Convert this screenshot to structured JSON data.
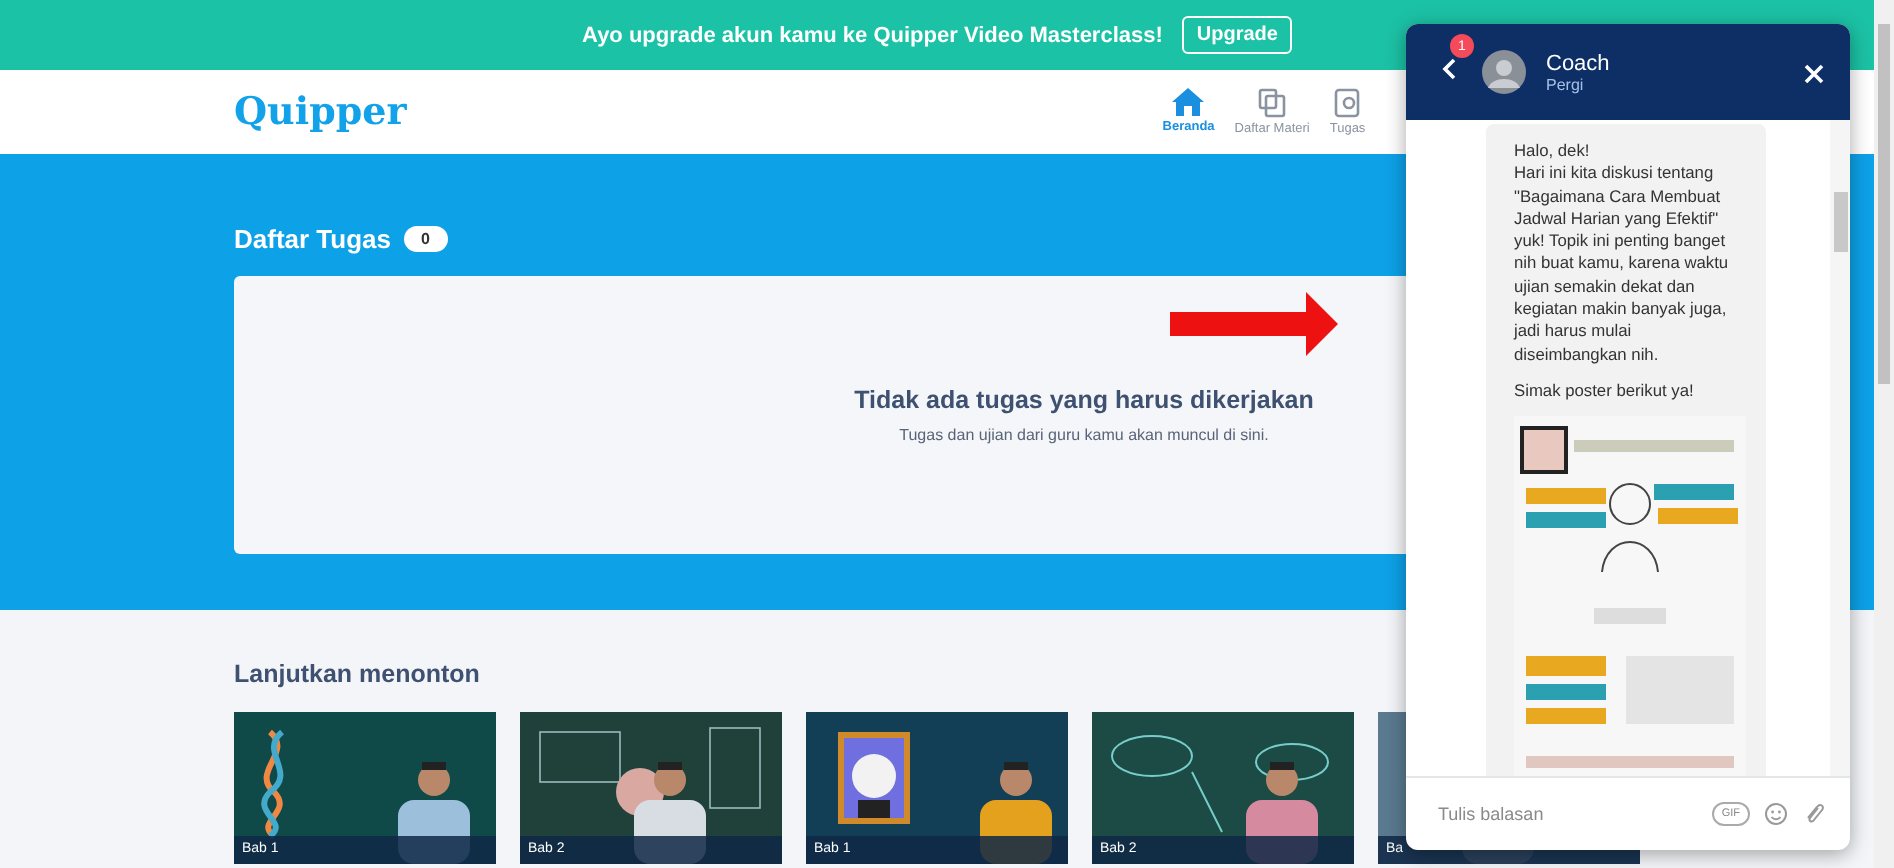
{
  "banner": {
    "text": "Ayo upgrade akun kamu ke Quipper Video Masterclass!",
    "button": "Upgrade"
  },
  "header": {
    "logo": "Quipper",
    "nav": [
      {
        "label": "Beranda",
        "kind": "home",
        "selected": true
      },
      {
        "label": "Daftar Materi",
        "kind": "pages",
        "selected": false
      },
      {
        "label": "Tugas",
        "kind": "task",
        "selected": false
      }
    ]
  },
  "tasks": {
    "title": "Daftar Tugas",
    "count": "0",
    "empty_title": "Tidak ada tugas yang harus dikerjakan",
    "empty_text": "Tugas dan ujian dari guru kamu akan muncul di sini."
  },
  "continue": {
    "title": "Lanjutkan menonton",
    "videos": [
      {
        "label": "Bab 1"
      },
      {
        "label": "Bab 2"
      },
      {
        "label": "Bab 1"
      },
      {
        "label": "Bab 2"
      },
      {
        "label": "Ba"
      }
    ]
  },
  "chat": {
    "unread": "1",
    "name": "Coach",
    "status": "Pergi",
    "messages": [
      "Halo, dek!\nHari ini kita diskusi tentang \"Bagaimana Cara Membuat Jadwal Harian yang Efektif\" yuk! Topik ini penting banget nih buat kamu, karena waktu ujian semakin dekat dan kegiatan makin banyak juga, jadi harus mulai diseimbangkan nih.",
      "Simak poster berikut ya!"
    ],
    "attachment": {
      "kind": "picture"
    },
    "input": {
      "placeholder": "Tulis balasan"
    },
    "gif": "GIF"
  }
}
